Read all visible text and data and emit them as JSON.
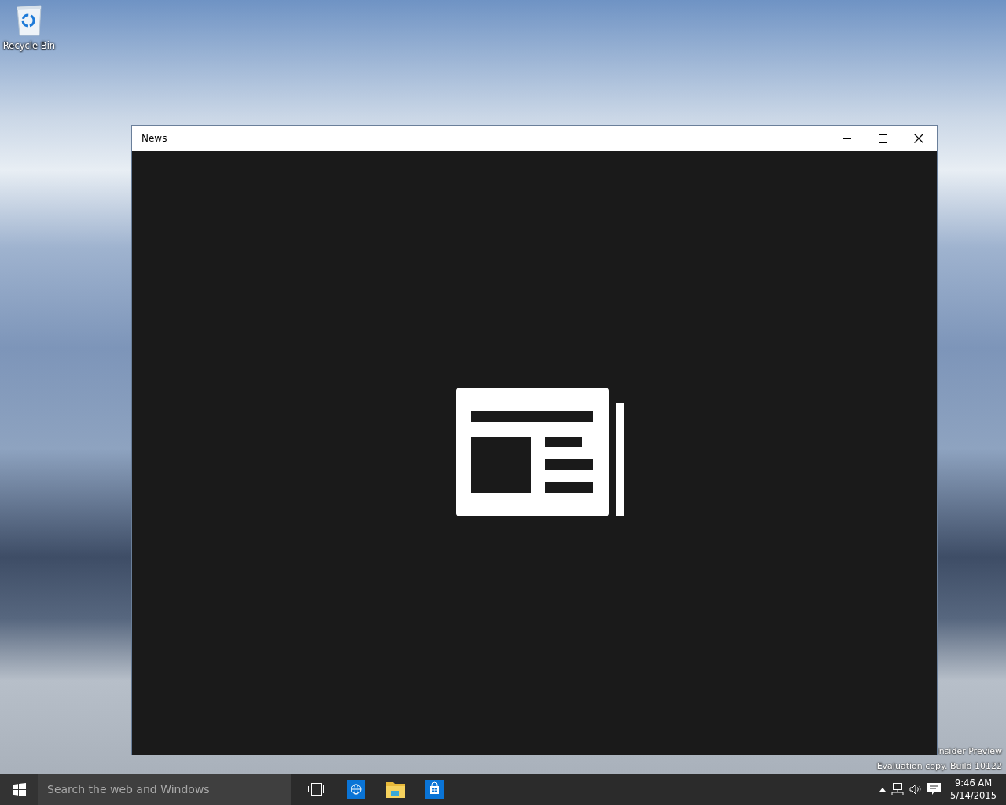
{
  "desktop": {
    "icons": [
      {
        "label": "Recycle Bin"
      }
    ],
    "build_info": [
      "Insider Preview",
      "Evaluation copy. Build 10122"
    ]
  },
  "window": {
    "title": "News"
  },
  "taskbar": {
    "search": {
      "placeholder": "Search the web and Windows"
    },
    "clock": {
      "time": "9:46 AM",
      "date": "5/14/2015"
    }
  }
}
